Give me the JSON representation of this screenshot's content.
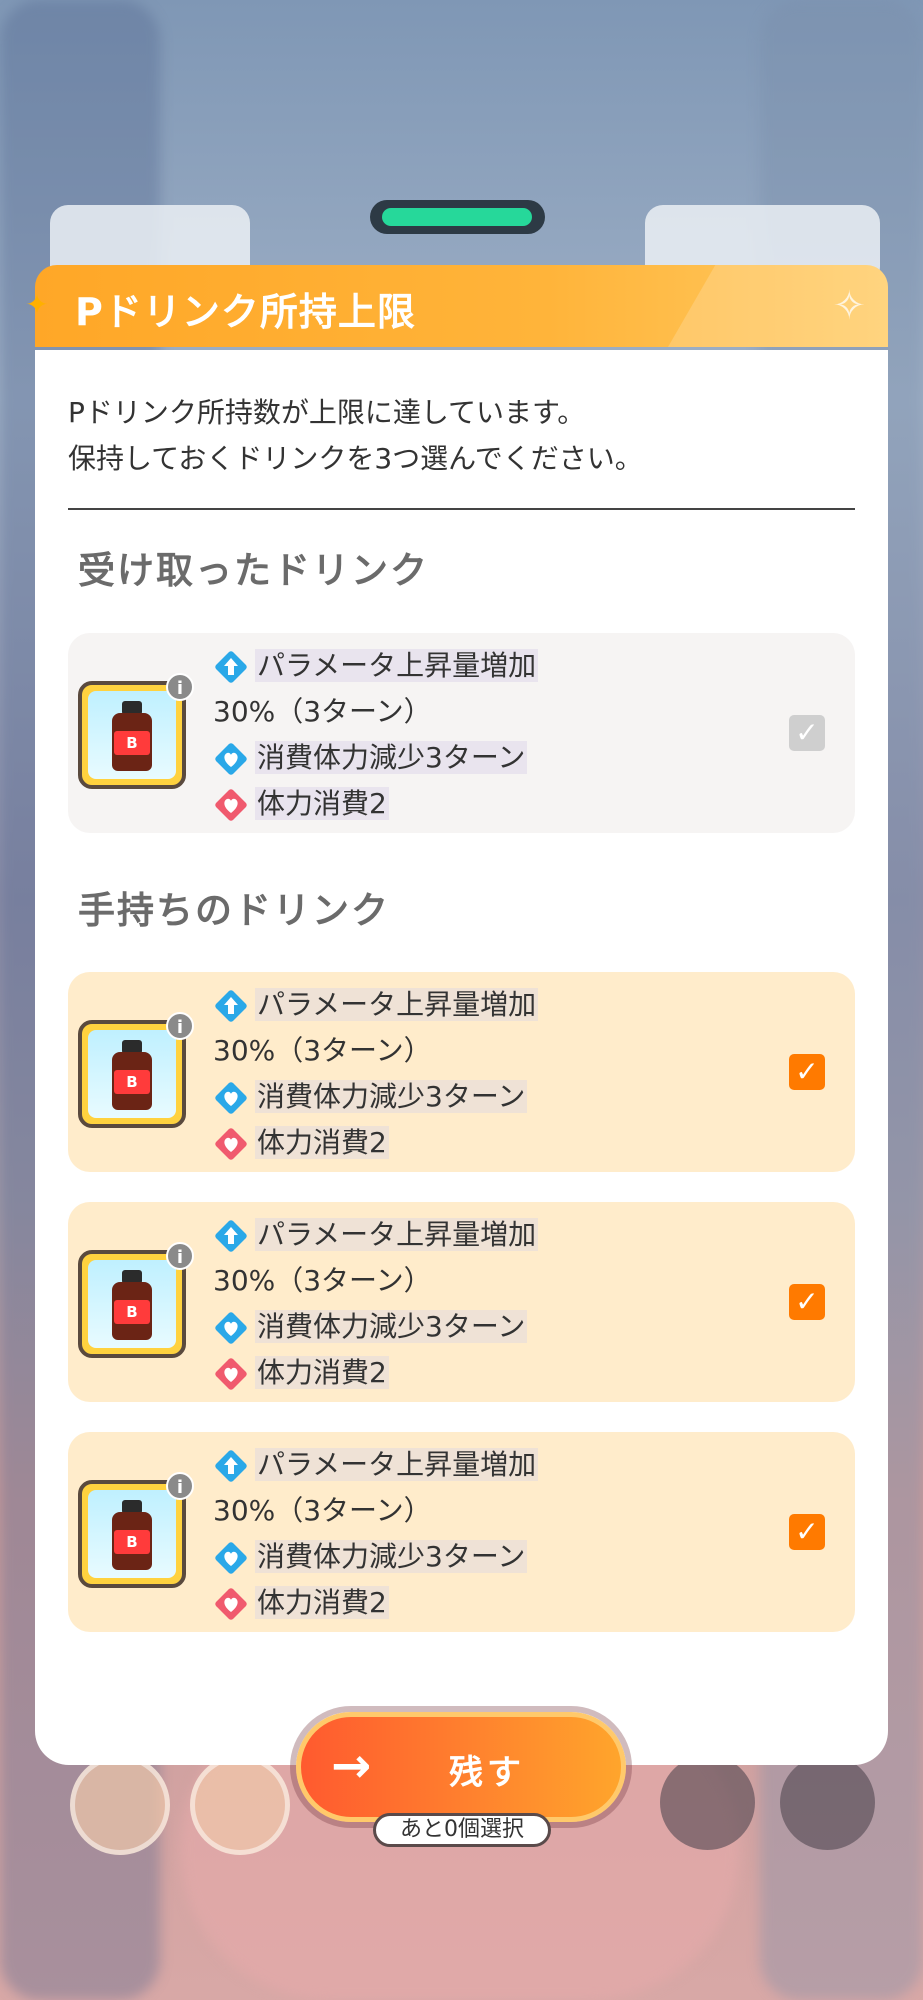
{
  "dialog": {
    "title": "Pドリンク所持上限",
    "intro_line1": "Pドリンク所持数が上限に達しています。",
    "intro_line2": "保持しておくドリンクを3つ選んでください。"
  },
  "received": {
    "section_title": "受け取ったドリンク",
    "drink": {
      "label": "B",
      "effect1": "パラメータ上昇量増加",
      "effect1b": "30%（3ターン）",
      "effect2": "消費体力減少3ターン",
      "effect3": "体力消費2",
      "checked": true,
      "disabled": true
    }
  },
  "owned": {
    "section_title": "手持ちのドリンク",
    "drinks": [
      {
        "label": "B",
        "effect1": "パラメータ上昇量増加",
        "effect1b": "30%（3ターン）",
        "effect2": "消費体力減少3ターン",
        "effect3": "体力消費2",
        "checked": true
      },
      {
        "label": "B",
        "effect1": "パラメータ上昇量増加",
        "effect1b": "30%（3ターン）",
        "effect2": "消費体力減少3ターン",
        "effect3": "体力消費2",
        "checked": true
      },
      {
        "label": "B",
        "effect1": "パラメータ上昇量増加",
        "effect1b": "30%（3ターン）",
        "effect2": "消費体力減少3ターン",
        "effect3": "体力消費2",
        "checked": true
      }
    ]
  },
  "footer": {
    "keep_label": "残す",
    "remaining": "あと0個選択"
  },
  "icons": {
    "effect1": "arrow-up-diamond-icon",
    "effect2": "stamina-diamond-icon",
    "effect3": "heart-diamond-icon",
    "info": "info-icon",
    "check": "check-icon"
  },
  "colors": {
    "header": "#ffa727",
    "owned_card": "#ffeccb",
    "received_card": "#f6f4f3",
    "checkbox_on": "#ff7a00",
    "button": "#ff7b2e"
  }
}
